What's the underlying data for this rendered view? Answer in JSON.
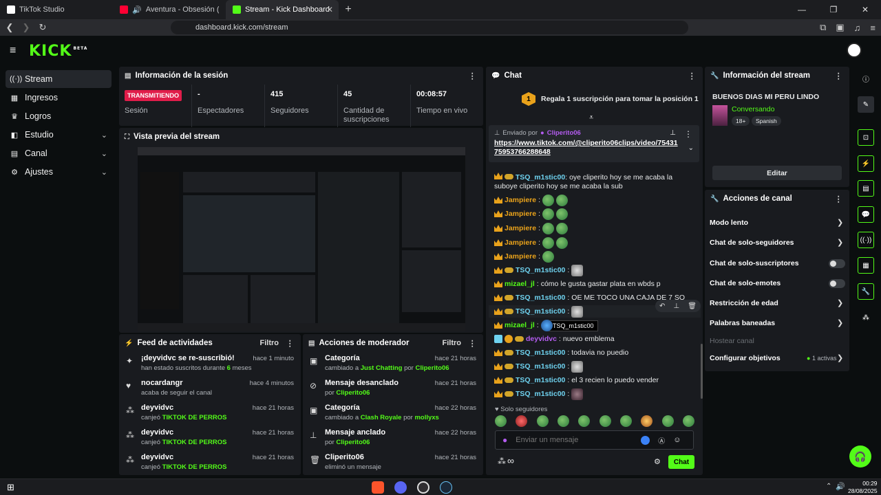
{
  "browser": {
    "tabs": [
      {
        "title": "TikTok Studio",
        "color": "#ffffff"
      },
      {
        "title": "Aventura - Obsesión (ft. Judy San",
        "color": "#ff0033"
      },
      {
        "title": "Stream - Kick Dashboard",
        "color": "#53fc18"
      }
    ],
    "url": "dashboard.kick.com/stream"
  },
  "brand": {
    "logo": "KICK",
    "beta": "BETA"
  },
  "sidebar": [
    {
      "label": "Stream",
      "icon": "stream-icon"
    },
    {
      "label": "Ingresos",
      "icon": "wallet-icon"
    },
    {
      "label": "Logros",
      "icon": "trophy-icon"
    },
    {
      "label": "Estudio",
      "icon": "studio-icon"
    },
    {
      "label": "Canal",
      "icon": "channel-icon"
    },
    {
      "label": "Ajustes",
      "icon": "gear-icon"
    }
  ],
  "session": {
    "title": "Información de la sesión",
    "status_badge": "TRANSMITIENDO",
    "stats": [
      {
        "value": "",
        "label": "Sesión"
      },
      {
        "value": "-",
        "label": "Espectadores"
      },
      {
        "value": "415",
        "label": "Seguidores"
      },
      {
        "value": "45",
        "label": "Cantidad de suscripciones"
      },
      {
        "value": "00:08:57",
        "label": "Tiempo en vivo"
      }
    ]
  },
  "preview": {
    "title": "Vista previa del stream"
  },
  "feed": {
    "title": "Feed de actividades",
    "filter": "Filtro",
    "items": [
      {
        "title": "¡deyvidvc se re-suscribió!",
        "time": "hace 1 minuto",
        "pre": "han estado suscritos durante ",
        "hl": "6",
        "post": " meses"
      },
      {
        "title": "nocardangr",
        "time": "hace 4 minutos",
        "pre": "acaba de seguir el canal",
        "hl": "",
        "post": ""
      },
      {
        "title": "deyvidvc",
        "time": "hace 21 horas",
        "pre": "canjeó ",
        "hl": "TIKTOK DE PERROS",
        "post": ""
      },
      {
        "title": "deyvidvc",
        "time": "hace 21 horas",
        "pre": "canjeó ",
        "hl": "TIKTOK DE PERROS",
        "post": ""
      },
      {
        "title": "deyvidvc",
        "time": "hace 21 horas",
        "pre": "canjeó ",
        "hl": "TIKTOK DE PERROS",
        "post": ""
      }
    ]
  },
  "mod": {
    "title": "Acciones de moderador",
    "filter": "Filtro",
    "items": [
      {
        "title": "Categoría",
        "time": "hace 21 horas",
        "pre": "cambiado a ",
        "hl": "Just Chatting",
        "mid": " por ",
        "hl2": "Cliperito06"
      },
      {
        "title": "Mensaje desanclado",
        "time": "hace 21 horas",
        "pre": "por ",
        "hl": "Cliperito06",
        "mid": "",
        "hl2": ""
      },
      {
        "title": "Categoría",
        "time": "hace 22 horas",
        "pre": "cambiado a ",
        "hl": "Clash Royale",
        "mid": " por ",
        "hl2": "mollyxs"
      },
      {
        "title": "Mensaje anclado",
        "time": "hace 22 horas",
        "pre": "por ",
        "hl": "Cliperito06",
        "mid": "",
        "hl2": ""
      },
      {
        "title": "Cliperito06",
        "time": "hace 21 horas",
        "pre": "eliminó un mensaje",
        "hl": "",
        "mid": "",
        "hl2": ""
      }
    ]
  },
  "chat": {
    "title": "Chat",
    "gift_rank": "1",
    "gift_text": "Regala 1 suscripción para tomar la posición 1",
    "pinned_by": "Enviado por",
    "pinned_user": "Cliperito06",
    "pinned_link": "https://www.tiktok.com/@cliperito06clips/video/7543175953766288648",
    "messages": [
      {
        "user": "TSQ_m1stic00",
        "color": "#6fd3f0",
        "text": "oye cliperito hoy se me acaba la suboye cliperito hoy se me acaba la sub"
      },
      {
        "user": "Jampiere",
        "color": "#e9a21b",
        "text": ""
      },
      {
        "user": "Jampiere",
        "color": "#e9a21b",
        "text": ""
      },
      {
        "user": "Jampiere",
        "color": "#e9a21b",
        "text": ""
      },
      {
        "user": "Jampiere",
        "color": "#e9a21b",
        "text": ""
      },
      {
        "user": "Jampiere",
        "color": "#e9a21b",
        "text": ""
      },
      {
        "user": "TSQ_m1stic00",
        "color": "#6fd3f0",
        "text": ""
      },
      {
        "user": "mizael_jl",
        "color": "#53fc18",
        "text": "cómo le gusta gastar plata en wbds p"
      },
      {
        "user": "TSQ_m1stic00",
        "color": "#6fd3f0",
        "text": "OE ME TOCO UNA CAJA DE 7 SO"
      },
      {
        "user": "TSQ_m1stic00",
        "color": "#6fd3f0",
        "text": ""
      },
      {
        "user": "mizael_jl",
        "color": "#53fc18",
        "text": ""
      },
      {
        "user": "deyvidvc",
        "color": "#b45cf0",
        "text": "nuevo emblema"
      },
      {
        "user": "TSQ_m1stic00",
        "color": "#6fd3f0",
        "text": "todavia no puedio"
      },
      {
        "user": "TSQ_m1stic00",
        "color": "#6fd3f0",
        "text": ""
      },
      {
        "user": "TSQ_m1stic00",
        "color": "#6fd3f0",
        "text": "el 3 recien lo puedo vender"
      },
      {
        "user": "TSQ_m1stic00",
        "color": "#6fd3f0",
        "text": ""
      }
    ],
    "tooltip": "TSQ_m1stic00",
    "followers_only": "Solo seguidores",
    "input_placeholder": "Enviar un mensaje",
    "send": "Chat"
  },
  "stream_info": {
    "title": "Información del stream",
    "stream_title": "BUENOS DIAS MI PERU LINDO",
    "category": "Conversando",
    "tags": [
      "18+",
      "Spanish"
    ],
    "edit": "Editar"
  },
  "channel_actions": {
    "title": "Acciones de canal",
    "items": [
      {
        "label": "Modo lento",
        "control": "chevron"
      },
      {
        "label": "Chat de solo-seguidores",
        "control": "chevron"
      },
      {
        "label": "Chat de solo-suscriptores",
        "control": "toggle"
      },
      {
        "label": "Chat de solo-emotes",
        "control": "toggle"
      },
      {
        "label": "Restricción de edad",
        "control": "chevron"
      },
      {
        "label": "Palabras baneadas",
        "control": "chevron"
      },
      {
        "label": "Hostear canal",
        "control": "none"
      },
      {
        "label": "Configurar objetivos",
        "control": "chevron"
      }
    ],
    "goals_active": "1 activas"
  },
  "taskbar": {
    "time": "00:29",
    "date": "28/08/2025"
  }
}
